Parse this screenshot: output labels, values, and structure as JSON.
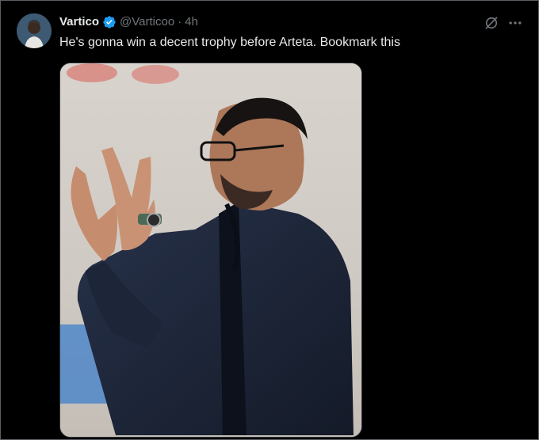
{
  "tweet": {
    "author_name": "Vartico",
    "handle": "@Varticoo",
    "separator": "·",
    "time": "4h",
    "text": "He's gonna win a decent trophy before Arteta. Bookmark this"
  },
  "icons": {
    "avatar": "avatar",
    "verified": "verified-badge-icon",
    "grok": "grok-icon",
    "more": "more-icon"
  },
  "colors": {
    "background": "#000000",
    "text_primary": "#e7e9ea",
    "text_secondary": "#71767b",
    "verified_blue": "#1d9bf0"
  }
}
